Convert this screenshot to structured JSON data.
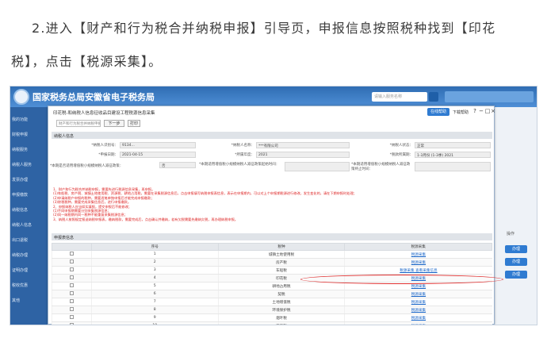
{
  "article": {
    "line1": "2.进入【财产和行为税合并纳税申报】引导页，申报信息按照税种找到【印花",
    "line2": "税】，点击【税源采集】。"
  },
  "portal": {
    "title": "国家税务总局安徽省电子税务局",
    "search_placeholder": "请输入服务名称",
    "side_items": [
      "我的功能",
      "财税申报",
      "纳税服务",
      "纳税人服务",
      "发票办理",
      "申报缴款",
      "纳税信息",
      "纳税人信息",
      "出口退税",
      "纳税办理",
      "证明办理",
      "税收优惠",
      "其他"
    ],
    "right_label": "操作",
    "right_buttons": [
      "办理",
      "办理",
      "办理"
    ],
    "accent": "#2f6db3"
  },
  "modal": {
    "title": "印花税-和纳税人信息征收品目建设工程税源信息采集",
    "help_button": "在线帮助",
    "help_text": "下载帮助",
    "win_controls": [
      "?",
      "−",
      "□",
      "×"
    ],
    "toolbar": {
      "select_value": "财产和行为税合并纳税申报",
      "prev_label": "下一步",
      "print_label": "打印"
    },
    "info_section": "纳税人信息",
    "fields": [
      {
        "label": "*纳税人识别号：",
        "value": "9134..."
      },
      {
        "label": "*纳税人名称：",
        "value": "***有限公司"
      },
      {
        "label": "*纳税人状态：",
        "value": "正常"
      },
      {
        "label": "*申报日期：",
        "value": "2021-04-15"
      },
      {
        "label": "*所属年度：",
        "value": "2021"
      },
      {
        "label": "*税款所属期：",
        "value": "1-3月份 (1-3季) 2021"
      },
      {
        "label": "*本期是否适用增值税小规模纳税人减征政策：",
        "value": "否"
      },
      {
        "label": "*本期适用增值税小规模纳税人减征政策起始时间：",
        "value": ""
      },
      {
        "label": "*本期适用增值税小规模纳税人减征政策终止时间：",
        "value": ""
      }
    ],
    "notice_lines": [
      "1、财产和行为税合并纳税申报，需要先进行税源信息采集，再申报。",
      "(1)车船税、房产税、城镇土地使用税、资源税、耕地占用税，需要在采集税源信息后，点击申报填写纳税申报表信息，表示在申报期内，可以对上个申报期税源进行修改，发生变化的，请在下期申报时处理；",
      "(2)申请纳税户申报的税种，需要逐笔单独申报后才能完成申报缴款；",
      "(3)除税税种，需要完成采集信息后，进行申报缴款。",
      "2、申报纳税人应当如实填报，提交申报后不能修改；",
      "(1)不同申报期需要分别采集税源信息；",
      "(2)同一纳税期内同一税种不能重复采集税源信息；",
      "3、纳税人按照规定报送纳税申报表，缴纳税款，需要完成后，点击确认并缴纳，若有欠税需要先缴纳欠税，再办理纳税申报。"
    ],
    "table_section": "申报表信息",
    "table_headers": [
      "",
      "序号",
      "税种",
      "税源采集"
    ],
    "rows": [
      {
        "no": "1",
        "tax": "城镇土地使用税",
        "action": "税源采集",
        "extra": ""
      },
      {
        "no": "2",
        "tax": "房产税",
        "action": "税源采集",
        "extra": ""
      },
      {
        "no": "3",
        "tax": "车船税",
        "action": "税源采集",
        "extra": "税源采集 查看采集信息"
      },
      {
        "no": "4",
        "tax": "印花税",
        "action": "税源采集",
        "extra": ""
      },
      {
        "no": "5",
        "tax": "耕地占用税",
        "action": "税源采集",
        "extra": ""
      },
      {
        "no": "6",
        "tax": "契税",
        "action": "税源采集",
        "extra": ""
      },
      {
        "no": "7",
        "tax": "土地增值税",
        "action": "税源采集",
        "extra": ""
      },
      {
        "no": "8",
        "tax": "环境保护税",
        "action": "税源采集",
        "extra": ""
      },
      {
        "no": "9",
        "tax": "烟叶税",
        "action": "税源采集",
        "extra": ""
      },
      {
        "no": "10",
        "tax": "资源税",
        "action": "税源采集",
        "extra": ""
      }
    ]
  }
}
